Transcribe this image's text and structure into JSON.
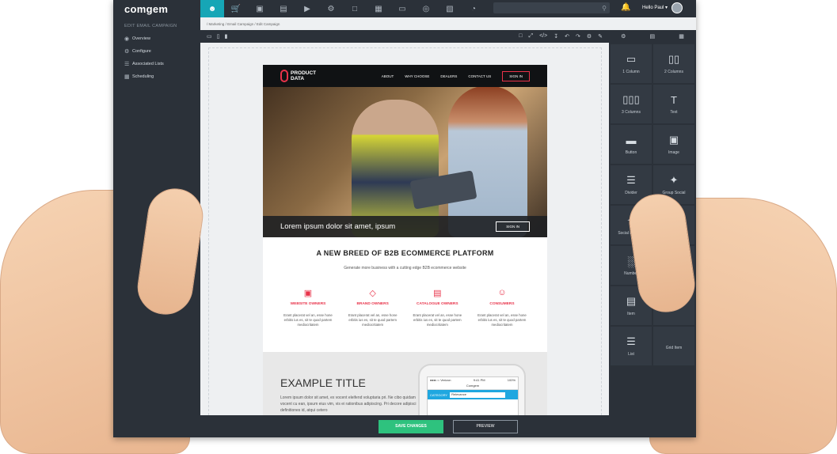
{
  "app": {
    "logo": "comgem"
  },
  "topbar": {
    "icons": [
      "user-icon",
      "cart-icon",
      "box-icon",
      "clipboard-icon",
      "megaphone-icon",
      "gear-icon",
      "folder-icon",
      "bag-icon",
      "monitor-icon",
      "globe-icon",
      "document-icon",
      "chart-icon"
    ],
    "user_label": "Hello Paul ▾"
  },
  "sidebar": {
    "title": "EDIT EMAIL CAMPAIGN",
    "items": [
      {
        "label": "Overview",
        "icon": "eye-icon"
      },
      {
        "label": "Configure",
        "icon": "gear-icon"
      },
      {
        "label": "Associated Lists",
        "icon": "list-icon"
      },
      {
        "label": "Scheduling",
        "icon": "calendar-icon"
      }
    ]
  },
  "breadcrumb": {
    "items": [
      "Marketing",
      "Email Campaign",
      "Edit Campaign"
    ],
    "separator": "/"
  },
  "email": {
    "brand_line1": "PRODUCT",
    "brand_line2": "DATA",
    "nav": [
      "ABOUT",
      "WHY CHOOSE",
      "DEALERS",
      "CONTACT US"
    ],
    "nav_signin": "SIGN IN",
    "hero_text": "Lorem ipsum dolor sit amet, ipsum",
    "hero_button": "SIGN IN",
    "section_title": "A NEW BREED OF B2B ECOMMERCE PLATFORM",
    "section_subtitle": "Generate more business with a cutting edge B2B ecommerce website",
    "features": [
      {
        "name": "WEBSITE OWNERS",
        "text": "Erant placerat vel an, esse hone erbitis ius es, sit te quod partem mediocritatem",
        "icon": "browser-icon"
      },
      {
        "name": "BRAND OWNERS",
        "text": "Erant placerat vel an, esse hone erbitis ius es, sit te quod partem mediocritatem",
        "icon": "tag-icon"
      },
      {
        "name": "CATALOGUE OWNERS",
        "text": "Erant placerat vel an, esse hone erbitis ius es, sit te quod partem mediocritatem",
        "icon": "catalogue-icon"
      },
      {
        "name": "CONSUMERS",
        "text": "Erant placerat vel an, esse hone erbitis ius es, sit te quod partem mediocritatem",
        "icon": "person-icon"
      }
    ],
    "example_title": "EXAMPLE TITLE",
    "example_text": "Lorem ipsum dolor sit amet, ex vocent eleifend voluptaria pri. Ne cibo quidam vocent cu ean, ipsum eius vim, vis ei rationibus adipiscing. Pri decore adipisci definitiones id, atqui cetero",
    "phone": {
      "carrier": "●●●○○ Verizon",
      "time": "9:41 PM",
      "battery": "100%",
      "title": "Comgem",
      "bar_label": "CATEGORY",
      "select_value": "Relevance"
    }
  },
  "panel": {
    "items": [
      {
        "label": "1 Column",
        "icon": "one-column-icon"
      },
      {
        "label": "2 Columns",
        "icon": "two-columns-icon"
      },
      {
        "label": "3 Columns",
        "icon": "three-columns-icon"
      },
      {
        "label": "Text",
        "icon": "text-icon"
      },
      {
        "label": "Button",
        "icon": "button-icon"
      },
      {
        "label": "Image",
        "icon": "image-icon"
      },
      {
        "label": "Divider",
        "icon": "divider-icon"
      },
      {
        "label": "Group Social",
        "icon": "share-icon"
      },
      {
        "label": "Social Element",
        "icon": "share-icon"
      },
      {
        "label": "",
        "icon": "blank"
      },
      {
        "label": "Number",
        "icon": "bar-chart-icon"
      },
      {
        "label": "",
        "icon": "blank"
      },
      {
        "label": "Item",
        "icon": "item-card-icon"
      },
      {
        "label": "La",
        "icon": "blank"
      },
      {
        "label": "List",
        "icon": "list-icon"
      },
      {
        "label": "Grid Item",
        "icon": "blank"
      }
    ]
  },
  "footer": {
    "save_label": "SAVE CHANGES",
    "preview_label": "PREVIEW"
  },
  "colors": {
    "accent_teal": "#16a6b6",
    "brand_red": "#e8334a",
    "save_green": "#2ec27e",
    "chrome_dark": "#2b3139"
  }
}
